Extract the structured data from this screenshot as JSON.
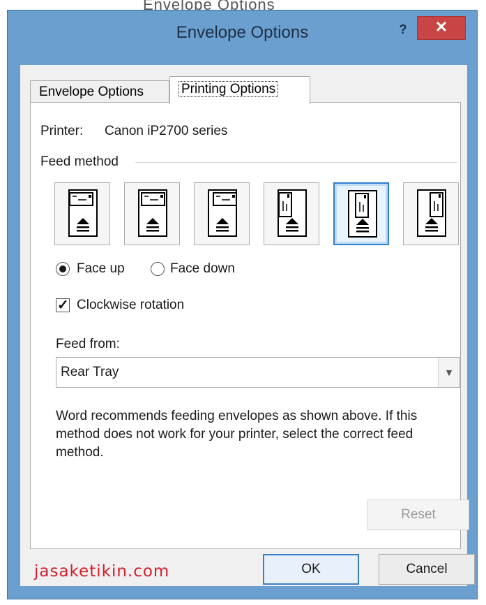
{
  "background_text": "Envelope Options",
  "dialog": {
    "title": "Envelope Options",
    "help_glyph": "?",
    "close_glyph": "✕"
  },
  "tabs": [
    {
      "label": "Envelope Options",
      "active": false
    },
    {
      "label": "Printing Options",
      "active": true
    }
  ],
  "printer": {
    "label": "Printer:",
    "name": "Canon iP2700 series"
  },
  "feed_method": {
    "label": "Feed method",
    "options": [
      {
        "icon": "envelope-horizontal-left-icon",
        "selected": false
      },
      {
        "icon": "envelope-horizontal-center-icon",
        "selected": false
      },
      {
        "icon": "envelope-horizontal-right-icon",
        "selected": false
      },
      {
        "icon": "envelope-vertical-left-icon",
        "selected": false
      },
      {
        "icon": "envelope-vertical-center-icon",
        "selected": true
      },
      {
        "icon": "envelope-vertical-right-icon",
        "selected": false
      }
    ]
  },
  "face": {
    "up_label": "Face up",
    "down_label": "Face down",
    "selected": "up"
  },
  "clockwise": {
    "label": "Clockwise rotation",
    "checked": true
  },
  "feed_from": {
    "label": "Feed from:",
    "value": "Rear Tray"
  },
  "info_text": "Word recommends feeding envelopes as shown above. If this method does not work for your printer, select the correct feed method.",
  "buttons": {
    "reset": "Reset",
    "ok": "OK",
    "cancel": "Cancel"
  },
  "watermark": "jasaketikin.com",
  "colors": {
    "titlebar": "#6a9fcf",
    "close": "#c94545",
    "selection": "#2f7fd4",
    "watermark": "#d21f2a"
  }
}
